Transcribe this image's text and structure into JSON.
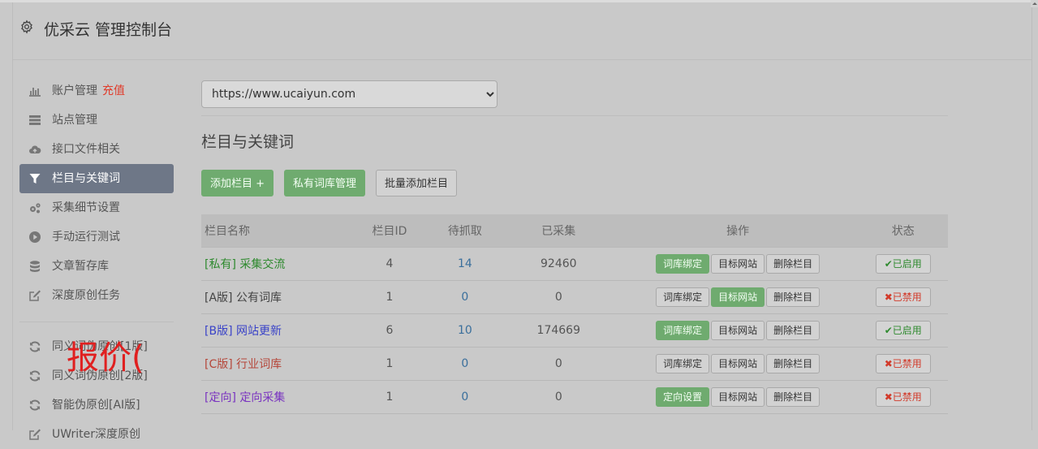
{
  "app": {
    "title": "优采云 管理控制台"
  },
  "sidebar": {
    "items": [
      {
        "label": "账户管理",
        "badge": "充值",
        "icon": "bar-chart-icon"
      },
      {
        "label": "站点管理",
        "icon": "server-icon"
      },
      {
        "label": "接口文件相关",
        "icon": "cloud-upload-icon"
      },
      {
        "label": "栏目与关键词",
        "icon": "filter-icon",
        "active": true
      },
      {
        "label": "采集细节设置",
        "icon": "gears-icon"
      },
      {
        "label": "手动运行测试",
        "icon": "play-circle-icon"
      },
      {
        "label": "文章暂存库",
        "icon": "database-icon"
      },
      {
        "label": "深度原创任务",
        "icon": "edit-icon"
      }
    ],
    "items2": [
      {
        "label": "同义词伪原创[1版]",
        "icon": "refresh-icon"
      },
      {
        "label": "同义词伪原创[2版]",
        "icon": "refresh-icon"
      },
      {
        "label": "智能伪原创[AI版]",
        "icon": "refresh-icon"
      },
      {
        "label": "UWriter深度原创",
        "icon": "edit-icon"
      }
    ],
    "stamp": "报价("
  },
  "main": {
    "site_select": "https://www.ucaiyun.com",
    "section_title": "栏目与关键词",
    "buttons": {
      "add": "添加栏目 +",
      "private_lib": "私有词库管理",
      "batch_add": "批量添加栏目"
    },
    "table": {
      "headers": [
        "栏目名称",
        "栏目ID",
        "待抓取",
        "已采集",
        "操作",
        "状态"
      ],
      "rows": [
        {
          "tag": "[私有]",
          "name": "采集交流",
          "color": "#2f8a2f",
          "id": "4",
          "pending": "14",
          "collected": "92460",
          "op1": "词库绑定",
          "op1_green": true,
          "op2": "目标网站",
          "op2_green": false,
          "op3": "删除栏目",
          "status": "已启用",
          "enabled": true
        },
        {
          "tag": "[A版]",
          "name": "公有词库",
          "color": "#444444",
          "id": "1",
          "pending": "0",
          "collected": "0",
          "op1": "词库绑定",
          "op1_green": false,
          "op2": "目标网站",
          "op2_green": true,
          "op3": "删除栏目",
          "status": "已禁用",
          "enabled": false
        },
        {
          "tag": "[B版]",
          "name": "网站更新",
          "color": "#3a43c8",
          "id": "6",
          "pending": "10",
          "collected": "174669",
          "op1": "词库绑定",
          "op1_green": true,
          "op2": "目标网站",
          "op2_green": false,
          "op3": "删除栏目",
          "status": "已启用",
          "enabled": true
        },
        {
          "tag": "[C版]",
          "name": "行业词库",
          "color": "#b5473a",
          "id": "1",
          "pending": "0",
          "collected": "0",
          "op1": "词库绑定",
          "op1_green": false,
          "op2": "目标网站",
          "op2_green": false,
          "op3": "删除栏目",
          "status": "已禁用",
          "enabled": false
        },
        {
          "tag": "[定向]",
          "name": "定向采集",
          "color": "#7a34c0",
          "id": "1",
          "pending": "0",
          "collected": "0",
          "op1": "定向设置",
          "op1_green": true,
          "op2": "目标网站",
          "op2_green": false,
          "op3": "删除栏目",
          "status": "已禁用",
          "enabled": false
        }
      ]
    }
  }
}
